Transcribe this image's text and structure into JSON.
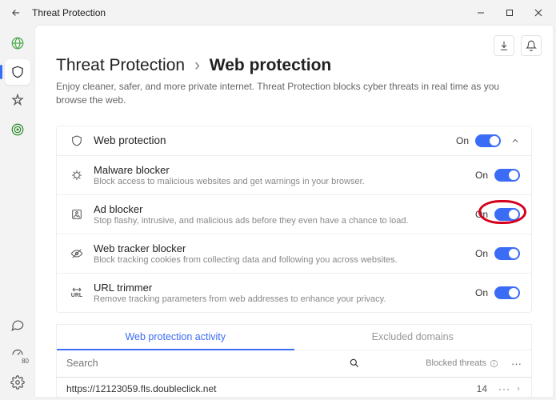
{
  "window": {
    "title": "Threat Protection"
  },
  "breadcrumb": {
    "root": "Threat Protection",
    "sep": "›",
    "leaf": "Web protection"
  },
  "description": "Enjoy cleaner, safer, and more private internet. Threat Protection blocks cyber threats in real time as you browse the web.",
  "sidebar_badge": "80",
  "header_row": {
    "title": "Web protection",
    "state": "On"
  },
  "features": [
    {
      "title": "Malware blocker",
      "sub": "Block access to malicious websites and get warnings in your browser.",
      "state": "On"
    },
    {
      "title": "Ad blocker",
      "sub": "Stop flashy, intrusive, and malicious ads before they even have a chance to load.",
      "state": "On",
      "highlighted": true
    },
    {
      "title": "Web tracker blocker",
      "sub": "Block tracking cookies from collecting data and following you across websites.",
      "state": "On"
    },
    {
      "title": "URL trimmer",
      "sub": "Remove tracking parameters from web addresses to enhance your privacy.",
      "state": "On"
    }
  ],
  "tabs": {
    "active": "Web protection activity",
    "inactive": "Excluded domains"
  },
  "search": {
    "placeholder": "Search",
    "col_label": "Blocked threats"
  },
  "activity_rows": [
    {
      "url": "https://12123059.fls.doubleclick.net",
      "count": "14"
    }
  ]
}
